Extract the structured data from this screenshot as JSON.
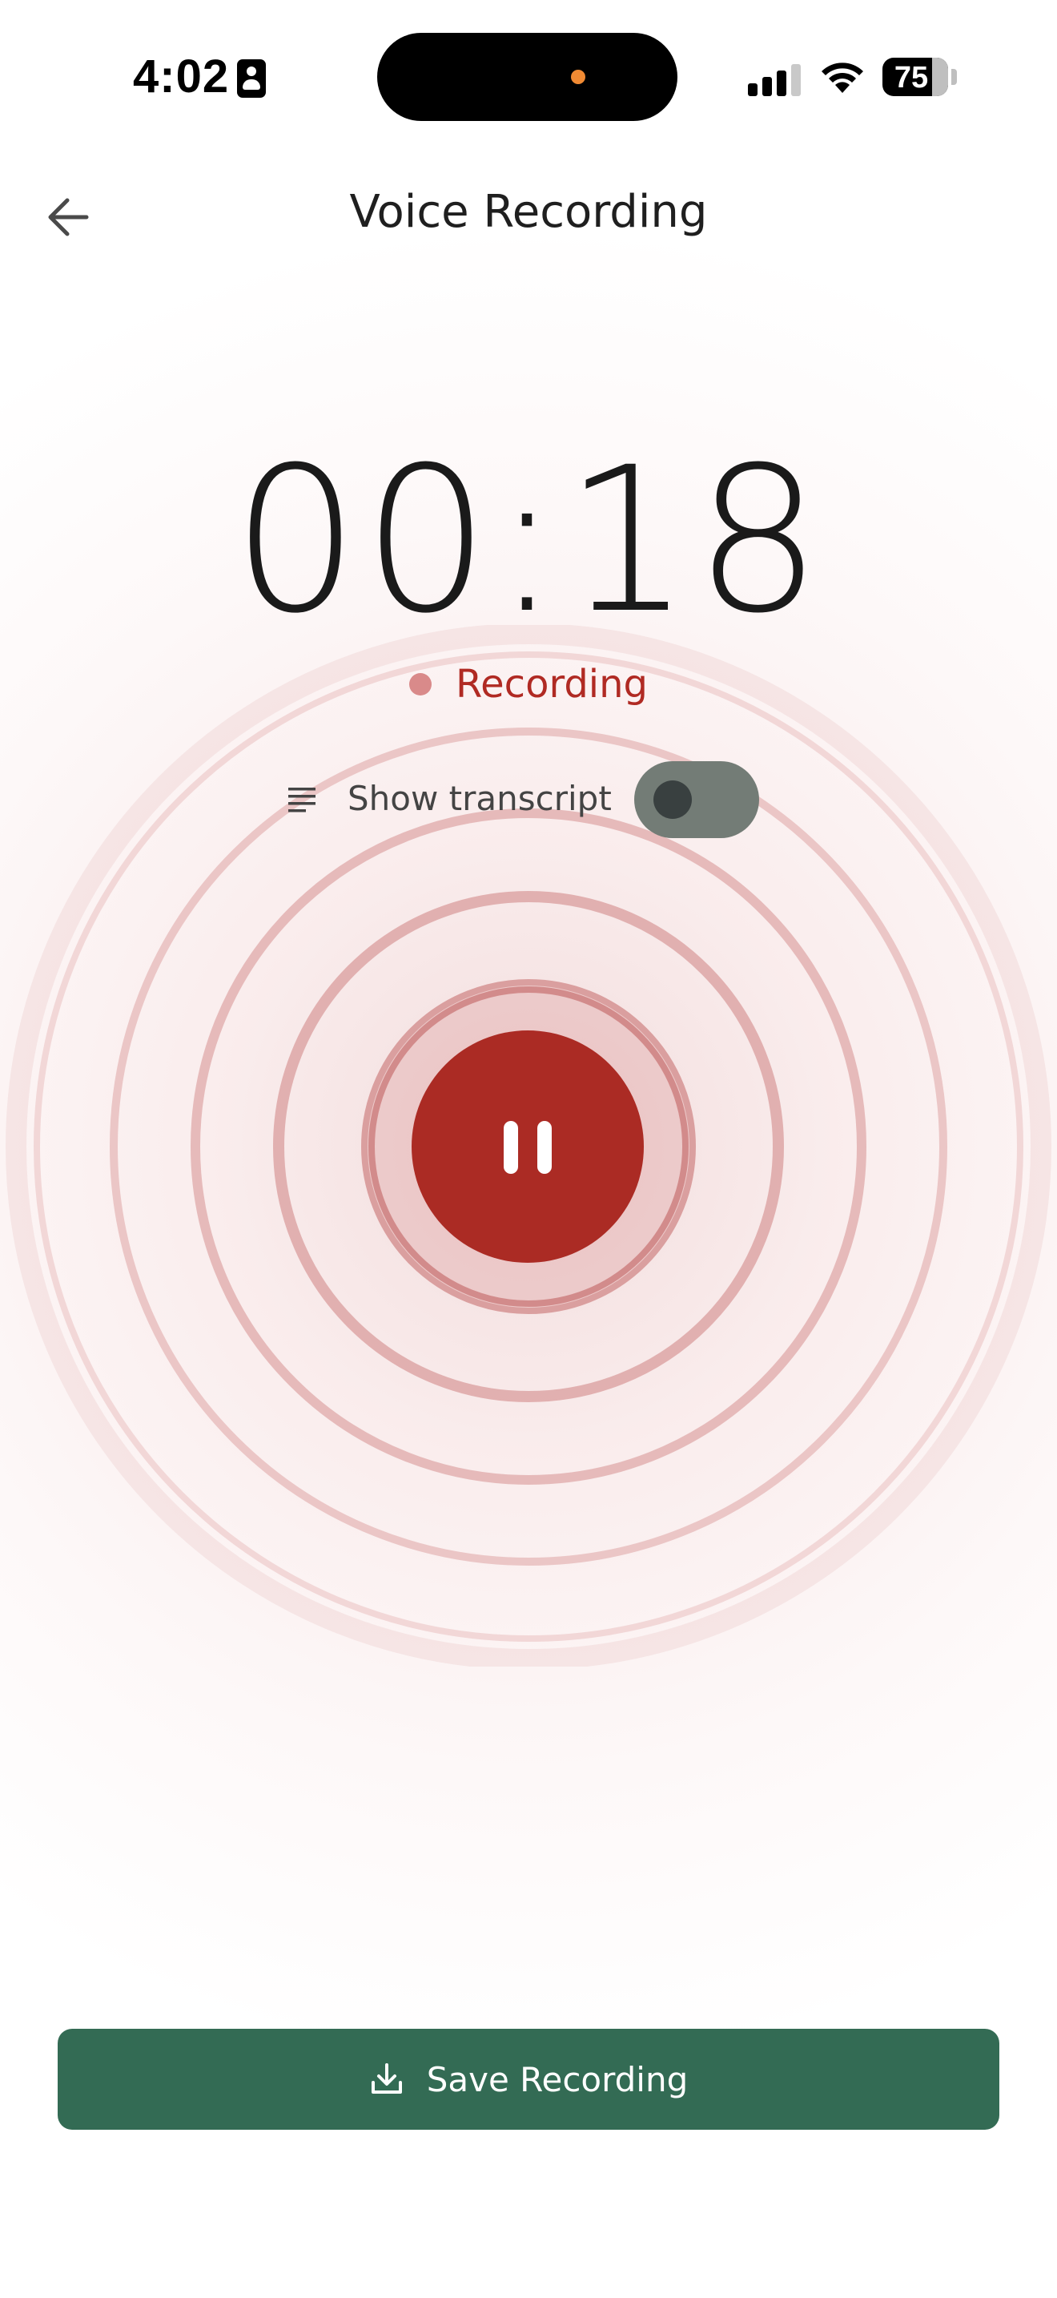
{
  "status_bar": {
    "time": "4:02",
    "battery_percent": "75",
    "icons": [
      "contact-card-icon",
      "camera-in-use-indicator",
      "cellular-signal-icon",
      "wifi-icon",
      "battery-icon"
    ]
  },
  "header": {
    "title": "Voice Recording",
    "back_icon": "arrow-left-icon"
  },
  "timer": {
    "elapsed": "00:18"
  },
  "recording_status": {
    "label": "Recording",
    "dot_color": "#d98a8a",
    "text_color": "#b02a23"
  },
  "transcript": {
    "icon": "lines-icon",
    "label": "Show transcript",
    "toggle_on": false
  },
  "record_control": {
    "icon": "pause-icon",
    "color": "#ab2b24"
  },
  "save": {
    "icon": "download-icon",
    "label": "Save Recording",
    "color": "#336b54"
  }
}
